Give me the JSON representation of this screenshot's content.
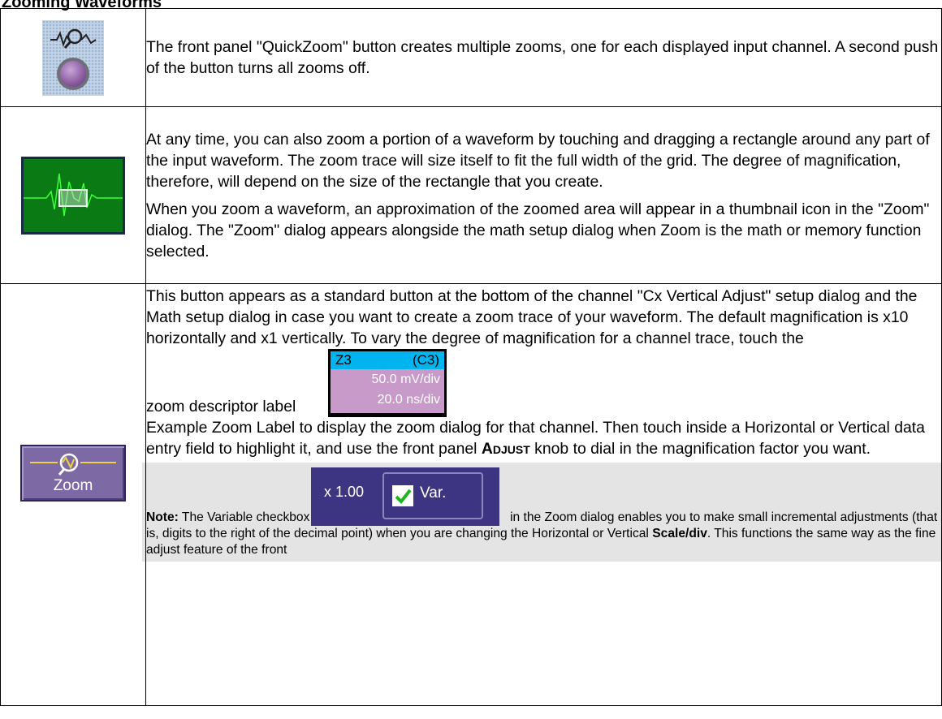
{
  "heading": "Zooming Waveforms",
  "rows": [
    {
      "text": "The front panel \"QuickZoom\" button creates multiple zooms, one for each displayed input channel. A second push of the button turns all zooms off."
    },
    {
      "paragraphs": [
        "At any time, you can also zoom a portion of a waveform by touching and dragging a rectangle around any part of the input waveform. The zoom trace will size itself to fit the full width of the grid. The degree of magnification, therefore, will depend on the size of the rectangle that you create.",
        "When you zoom a waveform, an approximation of the zoomed area will appear in a thumbnail icon in the \"Zoom\" dialog. The \"Zoom\" dialog appears alongside the math setup dialog when Zoom is the math or memory function selected."
      ]
    },
    {
      "button_label": "Zoom",
      "text_before_label": "This button appears as a standard button at the bottom of the channel \"Cx Vertical Adjust\" setup dialog and the Math setup dialog in case you want to create a zoom trace of your waveform. The default magnification is x10 horizontally and x1 vertically. To vary the degree of magnification for a channel trace, touch the",
      "label_lead": "zoom descriptor label",
      "descriptor": {
        "trace": "Z3",
        "source": "(C3)",
        "vscale": "50.0 mV/div",
        "hscale": "20.0 ns/div"
      },
      "text_after_label_1": "Example Zoom Label to display the zoom dialog for that channel. Then touch inside a Horizontal or Vertical data entry field to highlight it, and use the front panel",
      "knob_name": "Adjust",
      "text_after_label_2": "knob to dial in the magnification factor you want.",
      "note": {
        "lead": "Note:",
        "text_1": "The Variable checkbox",
        "control_value": "x 1.00",
        "control_label": "Var.",
        "text_2": "in the Zoom dialog enables you to make small incremental adjustments (that is, digits to the right of the decimal point) when you are changing the Horizontal or Vertical",
        "bold_term": "Scale/div",
        "text_3": ". This functions the same way as the fine adjust feature of the front"
      }
    }
  ],
  "colors": {
    "grid_green": "#0a7a14",
    "wave_green": "#3cff3c",
    "zoom_button": "#7d6aa5",
    "descriptor_header": "#00b4f0",
    "descriptor_body": "#c79ac9",
    "note_bg": "#e4e4e4",
    "checkmark": "#1fb51f"
  }
}
